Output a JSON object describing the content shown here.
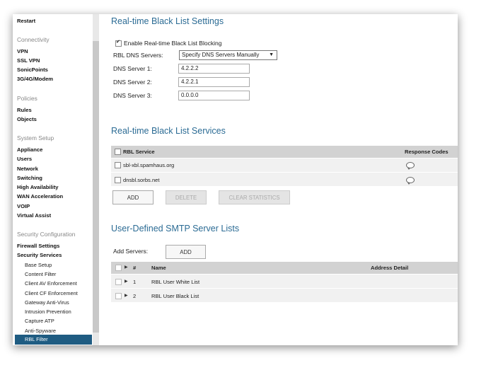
{
  "sidebar": {
    "restart": "Restart",
    "connectivity": {
      "title": "Connectivity",
      "items": [
        "VPN",
        "SSL VPN",
        "SonicPoints",
        "3G/4G/Modem"
      ]
    },
    "policies": {
      "title": "Policies",
      "items": [
        "Rules",
        "Objects"
      ]
    },
    "system_setup": {
      "title": "System Setup",
      "items": [
        "Appliance",
        "Users",
        "Network",
        "Switching",
        "High Availability",
        "WAN Acceleration",
        "VOIP",
        "Virtual Assist"
      ]
    },
    "security": {
      "title": "Security Configuration",
      "items": [
        "Firewall Settings",
        "Security Services"
      ],
      "sub_items": [
        "Base Setup",
        "Content Filter",
        "Client AV Enforcement",
        "Client CF Enforcement",
        "Gateway Anti-Virus",
        "Intrusion Prevention",
        "Capture ATP",
        "Anti-Spyware"
      ],
      "active": "RBL Filter"
    }
  },
  "settings": {
    "title": "Real-time Black List Settings",
    "enable_label": "Enable Real-time Black List Blocking",
    "enable_checked": true,
    "rbl_dns_label": "RBL DNS Servers:",
    "rbl_dns_value": "Specify DNS Servers Manually",
    "dns1_label": "DNS Server 1:",
    "dns1_value": "4.2.2.2",
    "dns2_label": "DNS Server 2:",
    "dns2_value": "4.2.2.1",
    "dns3_label": "DNS Server 3:",
    "dns3_value": "0.0.0.0"
  },
  "services": {
    "title": "Real-time Black List Services",
    "col_service": "RBL Service",
    "col_codes": "Response Codes",
    "rows": [
      "sbl-xbl.spamhaus.org",
      "dnsbl.sorbs.net"
    ],
    "add_label": "ADD",
    "delete_label": "DELETE",
    "clear_label": "CLEAR STATISTICS"
  },
  "smtp": {
    "title": "User-Defined SMTP Server Lists",
    "add_servers_label": "Add Servers:",
    "add_label": "ADD",
    "col_num": "#",
    "col_name": "Name",
    "col_address": "Address Detail",
    "rows": [
      {
        "num": "1",
        "name": "RBL User White List"
      },
      {
        "num": "2",
        "name": "RBL User Black List"
      }
    ]
  }
}
